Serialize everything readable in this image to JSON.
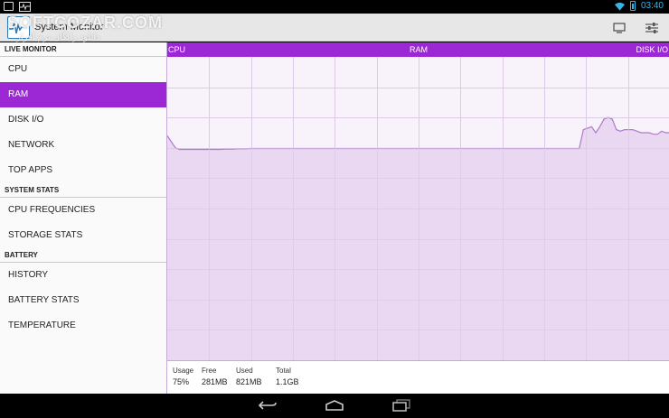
{
  "status_bar": {
    "time": "03:40"
  },
  "app": {
    "title": "System Monitor"
  },
  "watermark": {
    "text": "SOFTCOZAR.COM",
    "sub": "دانلود رایگان نرم افزار"
  },
  "sidebar": {
    "sections": [
      {
        "header": "LIVE MONITOR",
        "items": [
          "CPU",
          "RAM",
          "DISK I/O",
          "NETWORK",
          "TOP APPS"
        ]
      },
      {
        "header": "SYSTEM STATS",
        "items": [
          "CPU FREQUENCIES",
          "STORAGE STATS"
        ]
      },
      {
        "header": "BATTERY",
        "items": [
          "HISTORY",
          "BATTERY STATS",
          "TEMPERATURE"
        ]
      }
    ],
    "active_item": "RAM"
  },
  "tabs": {
    "left": "CPU",
    "center": "RAM",
    "right": "DISK I/O"
  },
  "chart_data": {
    "type": "area",
    "title": "",
    "xlabel": "",
    "ylabel": "",
    "ylim": [
      0,
      100
    ],
    "grid": true,
    "series": [
      {
        "values": [
          74,
          72,
          70,
          69.5,
          69.5,
          69.5,
          69.5,
          69.5,
          69.5,
          69.5,
          69.5,
          69.5,
          69.5,
          69.5,
          69.6,
          69.6,
          69.6,
          69.7,
          69.7,
          69.7,
          69.8,
          69.8,
          69.8,
          69.8,
          69.8,
          69.8,
          69.8,
          69.8,
          69.8,
          69.8,
          69.8,
          69.8,
          69.8,
          69.8,
          69.8,
          69.8,
          69.8,
          69.8,
          69.8,
          69.8,
          69.8,
          69.8,
          69.8,
          69.8,
          69.8,
          69.8,
          69.8,
          69.8,
          69.8,
          69.8,
          69.8,
          69.8,
          69.8,
          69.8,
          69.8,
          69.8,
          69.8,
          69.8,
          69.8,
          69.8,
          69.8,
          69.8,
          69.8,
          69.8,
          69.8,
          69.8,
          69.8,
          69.8,
          69.8,
          69.8,
          69.8,
          69.8,
          69.8,
          69.8,
          69.8,
          69.8,
          69.8,
          69.8,
          69.8,
          69.8,
          69.8,
          69.8,
          69.8,
          69.8,
          69.8,
          69.8,
          69.8,
          69.8,
          69.8,
          69.8,
          69.8,
          69.8,
          69.8,
          69.8,
          69.8,
          69.8,
          69.8,
          69.8,
          69.8,
          69.8,
          69.8,
          76,
          76.5,
          77,
          75,
          77,
          79.5,
          80,
          79.5,
          76,
          75.5,
          76,
          76,
          76,
          75.5,
          75,
          75,
          75,
          74.5,
          74.5,
          75.5,
          75,
          75
        ]
      }
    ]
  },
  "stats": {
    "usage_label": "Usage",
    "usage_value": "75%",
    "free_label": "Free",
    "free_value": "281MB",
    "used_label": "Used",
    "used_value": "821MB",
    "total_label": "Total",
    "total_value": "1.1GB"
  },
  "colors": {
    "accent": "#9c27d4",
    "fill": "#e6cff0",
    "line": "#b07ac8",
    "grid": "#dccbe6"
  },
  "icons": {
    "screen": "monitor-icon",
    "settings": "sliders-icon",
    "back": "back-icon",
    "home": "home-icon",
    "recents": "recents-icon"
  }
}
